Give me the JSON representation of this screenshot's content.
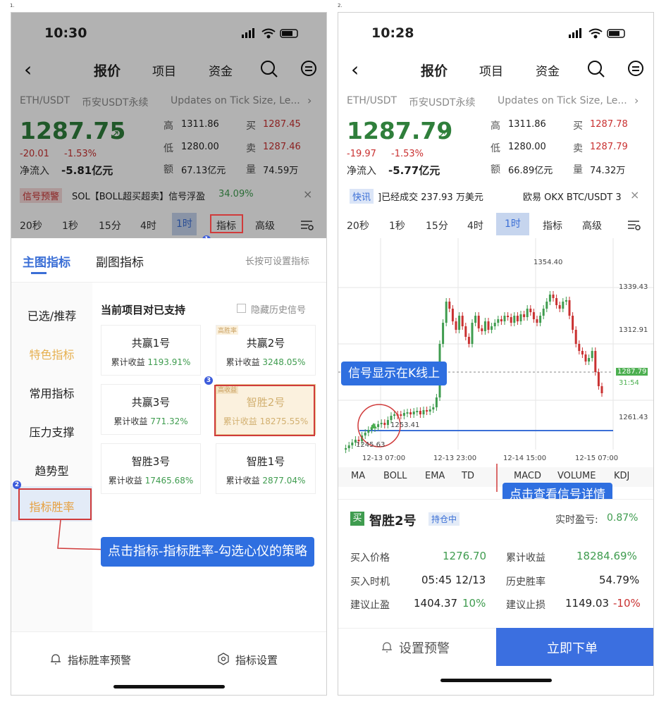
{
  "steps": [
    "1.",
    "2."
  ],
  "colors": {
    "accent": "#2f6fe0",
    "red": "#c93131",
    "green": "#3f9c4f",
    "callout": "#2f6fe0"
  },
  "phone1": {
    "status": {
      "time": "10:30",
      "signal": "signal-icon",
      "wifi": "wifi-icon",
      "battery": "battery-icon"
    },
    "nav": {
      "back": "‹",
      "tabs": [
        "报价",
        "项目",
        "资金"
      ]
    },
    "ticker": {
      "pair": "ETH/USDT",
      "market": "币安USDT永续",
      "news": "Updates on Tick Size, Le...",
      "news_arrow": "›"
    },
    "price": {
      "last": "1287.75",
      "arrow": "↗",
      "change": "-20.01",
      "pct": "-1.53%",
      "flow_label": "净流入",
      "flow": "-5.81亿元",
      "high_label": "高",
      "high": "1311.86",
      "low_label": "低",
      "low": "1280.00",
      "amt_label": "额",
      "amt": "67.13亿元",
      "buy_label": "买",
      "buy": "1287.45",
      "sell_label": "卖",
      "sell": "1287.46",
      "vol_label": "量",
      "vol": "74.59万"
    },
    "alert": {
      "tag": "信号预警",
      "text": "SOL【BOLL超买超卖】信号浮盈",
      "pct": "34.09%",
      "close": "×"
    },
    "timeframes": [
      "20秒",
      "1秒",
      "15分",
      "4时",
      "1时",
      "指标",
      "高级"
    ],
    "panel": {
      "tab_main": "主图指标",
      "tab_sub": "副图指标",
      "hint": "长按可设置指标",
      "menu": [
        "已选/推荐",
        "特色指标",
        "常用指标",
        "压力支撑",
        "趋势型",
        "指标胜率"
      ],
      "section_title": "当前项目对已支持",
      "hide_label": "隐藏历史信号",
      "cards": [
        {
          "name": "共赢1号",
          "ret_label": "累计收益",
          "ret": "1193.91%",
          "tag": ""
        },
        {
          "name": "共赢2号",
          "ret_label": "累计收益",
          "ret": "3248.05%",
          "tag": "高胜率"
        },
        {
          "name": "共赢3号",
          "ret_label": "累计收益",
          "ret": "771.32%",
          "tag": ""
        },
        {
          "name": "智胜2号",
          "ret_label": "累计收益",
          "ret": "18275.55%",
          "tag": "高收益"
        },
        {
          "name": "智胜3号",
          "ret_label": "累计收益",
          "ret": "17465.68%",
          "tag": ""
        },
        {
          "name": "智胜1号",
          "ret_label": "累计收益",
          "ret": "2877.04%",
          "tag": ""
        }
      ],
      "bottom": {
        "alert": "指标胜率预警",
        "settings": "指标设置"
      }
    },
    "callout": "点击指标-指标胜率-勾选心仪的策略",
    "markers": [
      "1",
      "2",
      "3"
    ]
  },
  "phone2": {
    "status": {
      "time": "10:28"
    },
    "nav": {
      "back": "‹",
      "tabs": [
        "报价",
        "项目",
        "资金"
      ]
    },
    "ticker": {
      "pair": "ETH/USDT",
      "market": "币安USDT永续",
      "news": "Updates on Tick Size, Le...",
      "news_arrow": "›"
    },
    "price": {
      "last": "1287.79",
      "arrow": "↗",
      "change": "-19.97",
      "pct": "-1.53%",
      "flow_label": "净流入",
      "flow": "-5.77亿元",
      "high_label": "高",
      "high": "1311.86",
      "low_label": "低",
      "low": "1280.00",
      "amt_label": "额",
      "amt": "66.89亿元",
      "buy_label": "买",
      "buy": "1287.78",
      "sell_label": "卖",
      "sell": "1287.79",
      "vol_label": "量",
      "vol": "74.32万"
    },
    "news_bar": {
      "tag": "快讯",
      "text": "]已经成交 237.93 万美元",
      "text2": "欧易 OKX BTC/USDT 3",
      "close": "×"
    },
    "timeframes": [
      "20秒",
      "1秒",
      "15分",
      "4时",
      "1时",
      "指标",
      "高级"
    ],
    "chart": {
      "price_labels": [
        "1339.43",
        "1312.91",
        "1287.79",
        "31:54",
        "1261.43"
      ],
      "annotations": {
        "high": "1354.40",
        "low": "1245.63",
        "buy_line": "1253.41"
      },
      "dates": [
        "12-13 07:00",
        "12-13 23:00",
        "12-14 15:00",
        "12-15 07:00"
      ]
    },
    "indicators": [
      "MA",
      "BOLL",
      "EMA",
      "TD",
      "MACD",
      "VOLUME",
      "KDJ"
    ],
    "callout_chart": "信号显示在K线上",
    "callout_detail": "点击查看信号详情",
    "detail": {
      "tag": "买",
      "name": "智胜2号",
      "status": "持仓中",
      "pnl_label": "实时盈亏:",
      "pnl": "0.87%",
      "rows": [
        {
          "l1": "买入价格",
          "v1": "1276.70",
          "l2": "累计收益",
          "v2": "18284.69%"
        },
        {
          "l1": "买入时机",
          "v1": "05:45 12/13",
          "l2": "历史胜率",
          "v2": "54.79%"
        },
        {
          "l1": "建议止盈",
          "v1": "1404.37",
          "v1b": "10%",
          "l2": "建议止损",
          "v2": "1149.03",
          "v2b": "-10%"
        }
      ],
      "btn_alert": "设置预警",
      "btn_order": "立即下单"
    }
  }
}
